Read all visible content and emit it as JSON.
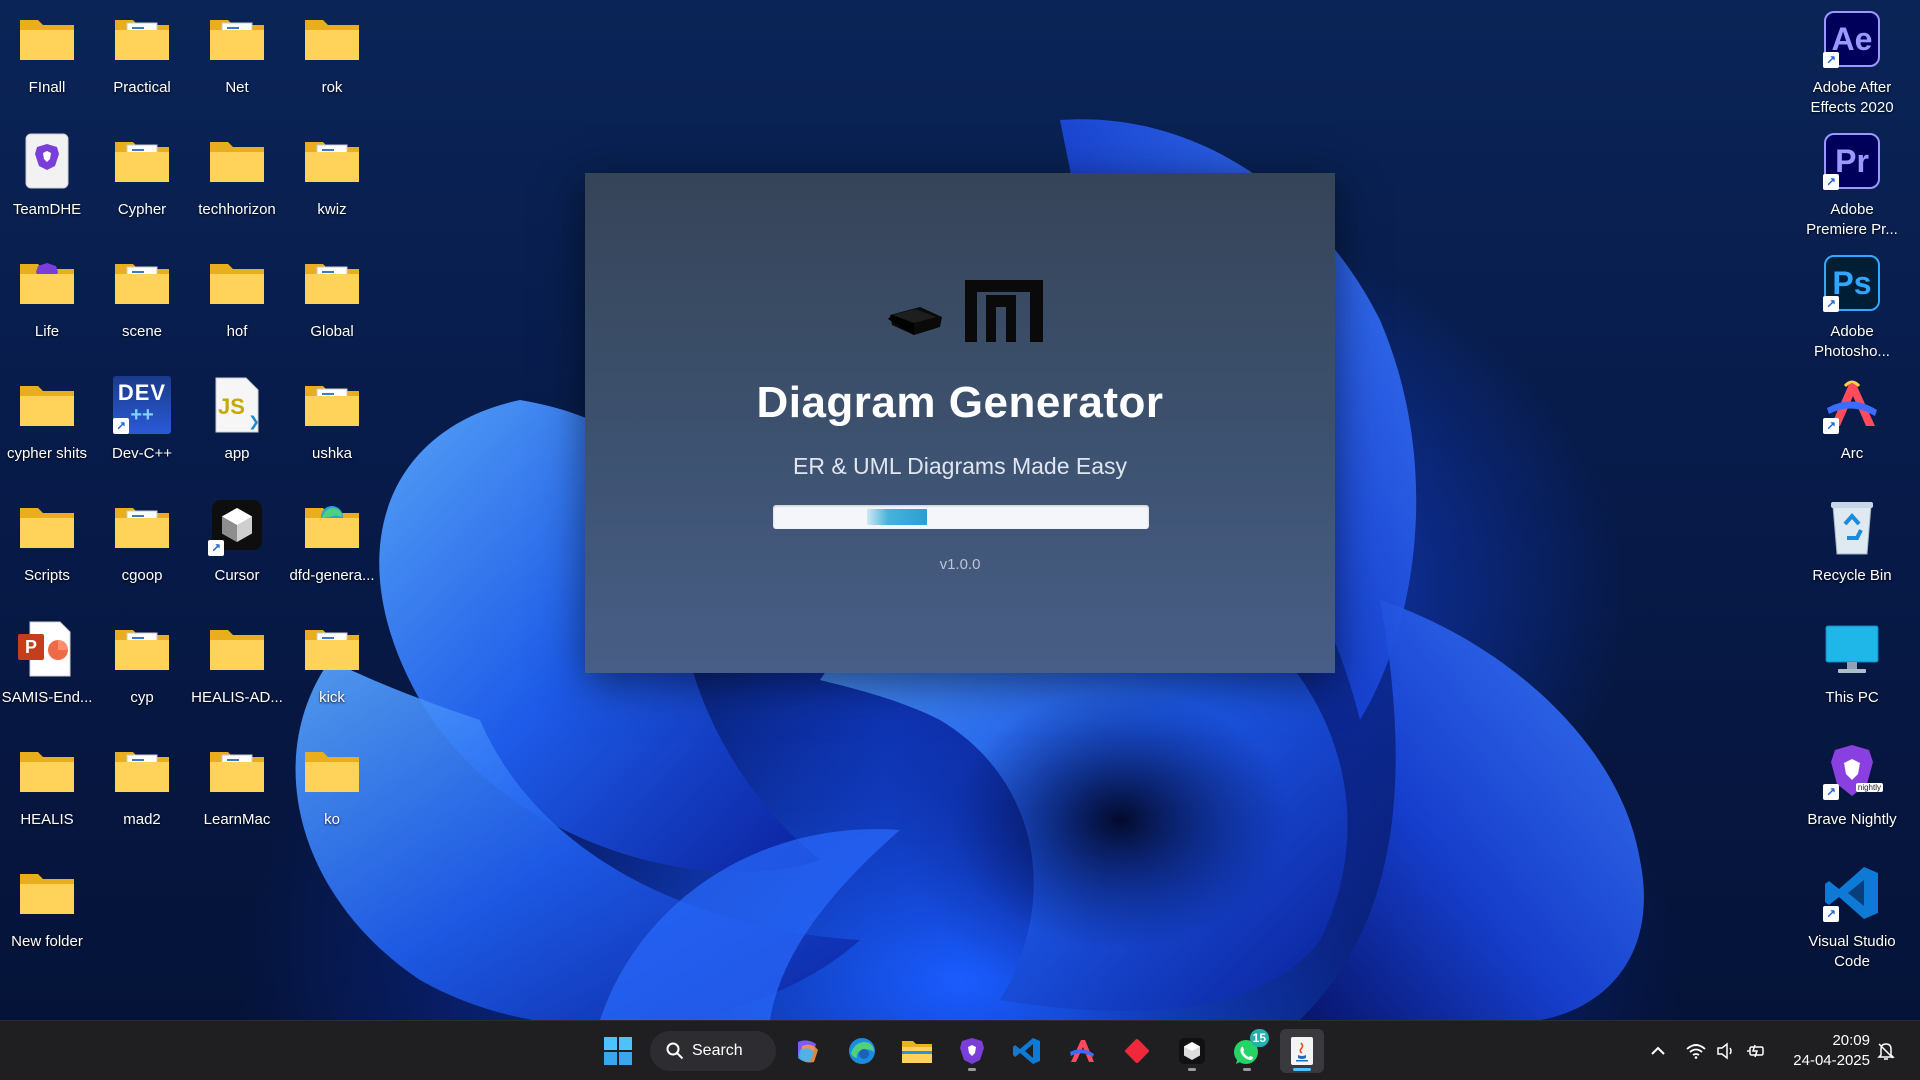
{
  "desktop": {
    "left_icons": [
      {
        "label": "FInall",
        "type": "folder"
      },
      {
        "label": "Practical",
        "type": "folder-doc"
      },
      {
        "label": "Net",
        "type": "folder-doc"
      },
      {
        "label": "rok",
        "type": "folder"
      },
      {
        "label": "TeamDHE",
        "type": "brave-file"
      },
      {
        "label": "Cypher",
        "type": "folder-doc"
      },
      {
        "label": "techhorizon",
        "type": "folder"
      },
      {
        "label": "kwiz",
        "type": "folder-doc"
      },
      {
        "label": "Life",
        "type": "folder-brave"
      },
      {
        "label": "scene",
        "type": "folder-doc"
      },
      {
        "label": "hof",
        "type": "folder"
      },
      {
        "label": "Global",
        "type": "folder-doc"
      },
      {
        "label": "cypher shits",
        "type": "folder"
      },
      {
        "label": "Dev-C++",
        "type": "devcpp"
      },
      {
        "label": "app",
        "type": "js-file"
      },
      {
        "label": "ushka",
        "type": "folder-doc"
      },
      {
        "label": "Scripts",
        "type": "folder"
      },
      {
        "label": "cgoop",
        "type": "folder-doc"
      },
      {
        "label": "Cursor",
        "type": "cursor"
      },
      {
        "label": "dfd-genera...",
        "type": "folder-edge"
      },
      {
        "label": "SAMIS-End...",
        "type": "pptx"
      },
      {
        "label": "cyp",
        "type": "folder-doc"
      },
      {
        "label": "HEALIS-AD...",
        "type": "folder"
      },
      {
        "label": "kick",
        "type": "folder-doc"
      },
      {
        "label": "HEALIS",
        "type": "folder"
      },
      {
        "label": "mad2",
        "type": "folder-doc"
      },
      {
        "label": "LearnMac",
        "type": "folder-doc"
      },
      {
        "label": "ko",
        "type": "folder"
      },
      {
        "label": "New folder",
        "type": "folder"
      }
    ],
    "right_icons": [
      {
        "label": "Adobe After Effects 2020",
        "type": "ae",
        "tile_text": "Ae"
      },
      {
        "label": "Adobe Premiere Pr...",
        "type": "pr",
        "tile_text": "Pr"
      },
      {
        "label": "Adobe Photosho...",
        "type": "ps",
        "tile_text": "Ps"
      },
      {
        "label": "Arc",
        "type": "arc"
      },
      {
        "label": "Recycle Bin",
        "type": "recycle"
      },
      {
        "label": "This PC",
        "type": "thispc"
      },
      {
        "label": "Brave Nightly",
        "type": "brave-nightly"
      },
      {
        "label": "Visual Studio Code",
        "type": "vscode"
      }
    ],
    "devcpp_tile_text": "DEV",
    "js_tile_text": "JS",
    "pptx_tile_text": "P",
    "nightly_tag": "nightly"
  },
  "splash": {
    "title": "Diagram Generator",
    "subtitle": "ER & UML Diagrams Made Easy",
    "version": "v1.0.0",
    "progress_fraction": 0.16,
    "colors": {
      "bg_top": "#364458",
      "bg_bottom": "#485e86",
      "progress": "#2a9ed2"
    }
  },
  "taskbar": {
    "search_label": "Search",
    "clock_time": "20:09",
    "clock_date": "24-04-2025",
    "whatsapp_badge": "15",
    "pinned": [
      "start-icon",
      "copilot-icon",
      "edge-icon",
      "file-explorer-icon",
      "brave-nightly-icon",
      "vscode-icon",
      "arc-icon",
      "git-icon",
      "cursor-icon",
      "whatsapp-icon",
      "java-app-icon"
    ]
  }
}
